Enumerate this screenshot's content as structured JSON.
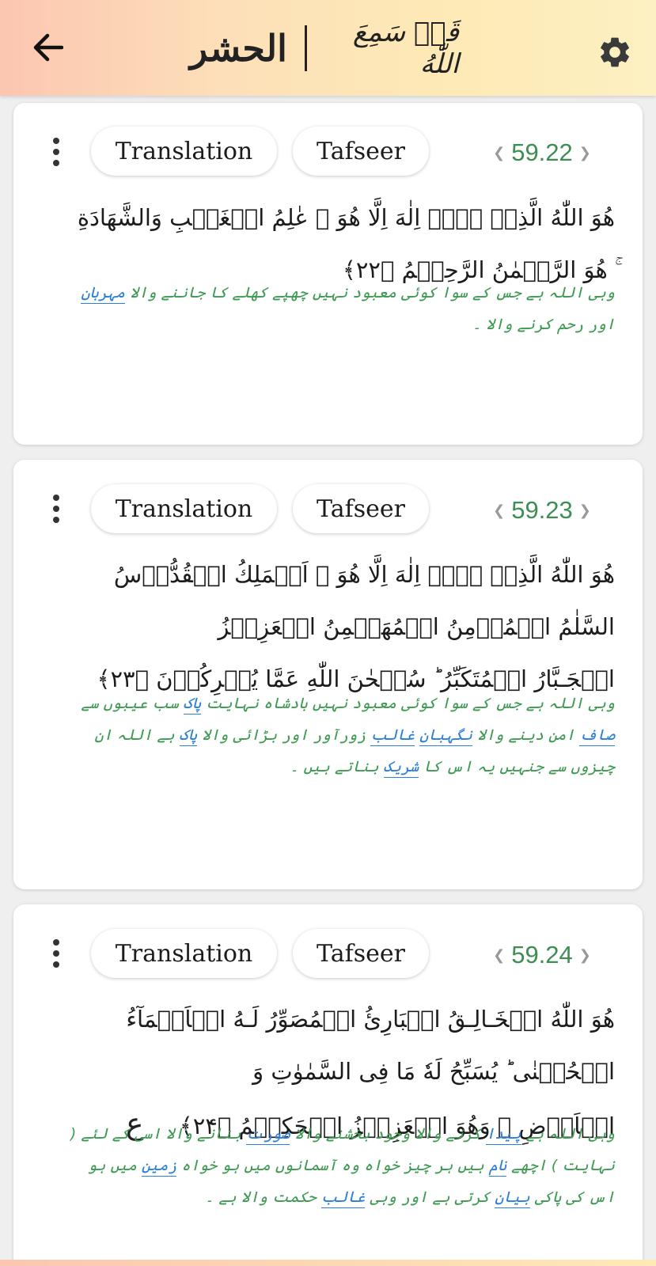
{
  "header": {
    "back_icon": "arrow-left-icon",
    "settings_icon": "gear-icon",
    "juz_title": "قَدۡ سَمِعَ اللّٰهُ",
    "surah_title": "الحشر",
    "background_colors": [
      "#fcc6b1",
      "#fdeab6"
    ]
  },
  "accent_colors": {
    "ayah_number": "#3e8e53",
    "urdu_text": "#3e9a52",
    "link": "#2b7fd8"
  },
  "cards": [
    {
      "translation_label": "Translation",
      "tafseer_label": "Tafseer",
      "ayah_number": "59.22",
      "arabic": [
        "هُوَ اللّٰهُ الَّذِىۡ لَاۤ اِلٰهَ اِلَّا هُوَ‌ ۚ عٰلِمُ الۡغَيۡبِ وَالشَّهَادَةِ‌ ۚ هُوَ الرَّحۡمٰنُ الرَّحِيۡمُ ﴿۲۲﴾"
      ],
      "urdu": {
        "part1": "وہی اللہ ہے جس کے سوا کوئی معبود نہیں چھپے کھلے کا جاننے والا",
        "link1": "مہربان",
        "part2": "اور رحم کرنے والا ۔"
      }
    },
    {
      "translation_label": "Translation",
      "tafseer_label": "Tafseer",
      "ayah_number": "59.23",
      "arabic": [
        "هُوَ اللّٰهُ الَّذِىۡ لَاۤ اِلٰهَ اِلَّا هُوَ‌ ۚ اَلۡمَلِكُ الۡقُدُّوۡسُ السَّلٰمُ الۡمُؤۡمِنُ الۡمُهَيۡمِنُ الۡعَزِيۡزُ",
        "الۡجَـبَّارُ الۡمُتَكَبِّرُ‌ ؕ سُبۡحٰنَ اللّٰهِ عَمَّا يُشۡرِكُوۡنَ ﴿۲۳﴾"
      ],
      "urdu": {
        "part1": "وہی اللہ ہے جس کے سوا کوئی معبود نہیں بادشاہ نہایت",
        "link1": "پاک",
        "part2": "سب عیبوں سے",
        "link2": "صاف",
        "part3": "امن دینے والا",
        "link3": "نگہبان",
        "link4": "غالب",
        "part4": "زورآور اور بڑائی والا",
        "link5": "پاک",
        "part5": "ہے اللہ ان چیزوں سے جنہیں یہ اس کا",
        "link6": "شریک",
        "part6": "بناتے ہیں ۔"
      }
    },
    {
      "translation_label": "Translation",
      "tafseer_label": "Tafseer",
      "ayah_number": "59.24",
      "arabic": [
        "هُوَ اللّٰهُ الۡخَـالِـقُ الۡبَارِئُ الۡمُصَوِّرُ‌ لَـهُ الۡاَسۡمَآءُ الۡحُسۡنٰى‌ ؕ يُسَبِّحُ لَهٗ مَا فِى السَّمٰوٰتِ وَ",
        "الۡاَرۡضِ‌ ۚ وَهُوَ الۡعَزِيۡزُ الۡحَكِيۡمُ ﴿۲۴﴾"
      ],
      "ruku_mark": "ع",
      "urdu": {
        "part1": "وہی اللہ ہے",
        "link1": "پیدا",
        "part2": "کرنے والا وجود بخشنے والا",
        "link2": "صورت",
        "part3": "بنانے والا اسی کے لئے ( نہایت ) اچھے",
        "link3": "نام",
        "part4": "ہیں ہر چیز خواہ وہ آسمانوں میں ہو خواہ",
        "link4": "زمین",
        "part5": "میں ہو اس کی پاکی",
        "link5": "بیان",
        "part6": "کرتی ہے اور وہی",
        "link6": "غالب",
        "part7": "حکمت والا ہے ۔"
      }
    }
  ]
}
